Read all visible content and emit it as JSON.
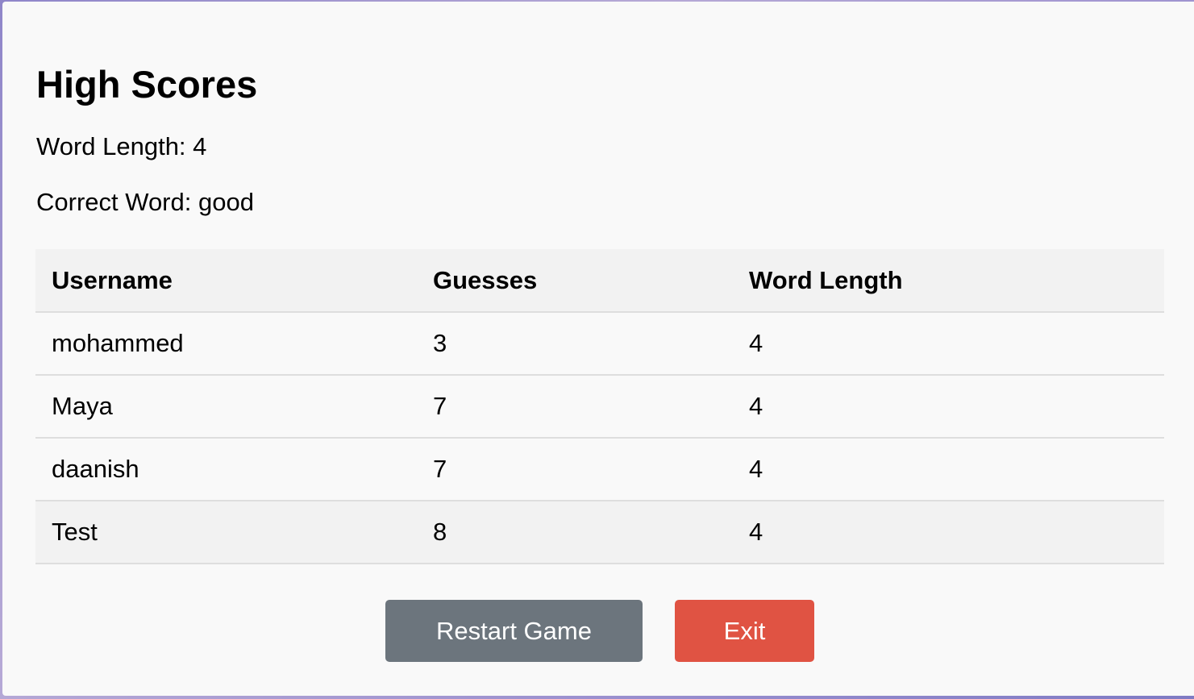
{
  "page": {
    "title": "High Scores",
    "word_length_label": "Word Length:",
    "word_length_value": "4",
    "correct_word_label": "Correct Word:",
    "correct_word_value": "good"
  },
  "table": {
    "headers": [
      "Username",
      "Guesses",
      "Word Length"
    ],
    "rows": [
      {
        "username": "mohammed",
        "guesses": "3",
        "word_length": "4"
      },
      {
        "username": "Maya",
        "guesses": "7",
        "word_length": "4"
      },
      {
        "username": "daanish",
        "guesses": "7",
        "word_length": "4"
      },
      {
        "username": "Test",
        "guesses": "8",
        "word_length": "4"
      }
    ]
  },
  "buttons": {
    "restart_label": "Restart Game",
    "exit_label": "Exit"
  },
  "colors": {
    "restart_button": "#6c757d",
    "exit_button": "#e05343",
    "panel_background": "#f9f9f9"
  }
}
